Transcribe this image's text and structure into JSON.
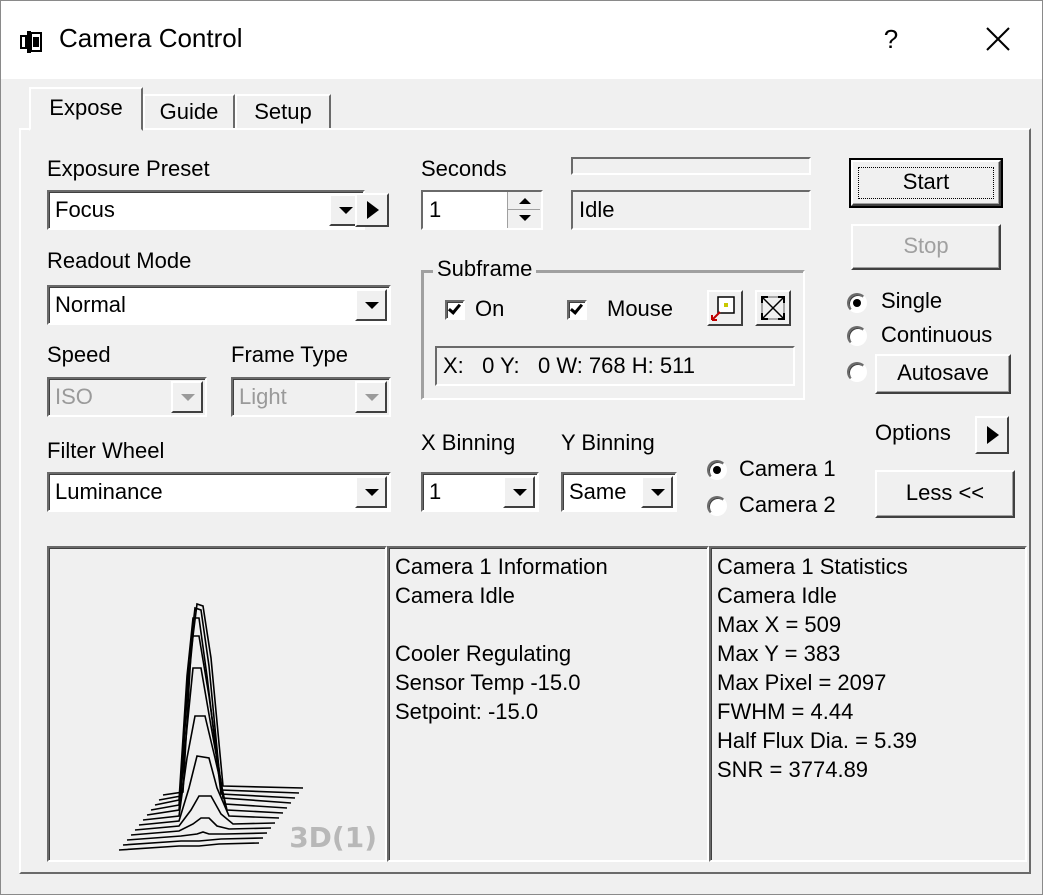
{
  "window": {
    "title": "Camera Control",
    "help_glyph": "?",
    "close_glyph": "✕"
  },
  "tabs": [
    {
      "label": "Expose",
      "active": true
    },
    {
      "label": "Guide",
      "active": false
    },
    {
      "label": "Setup",
      "active": false
    }
  ],
  "expose": {
    "exposure_preset_label": "Exposure Preset",
    "exposure_preset_value": "Focus",
    "seconds_label": "Seconds",
    "seconds_value": "1",
    "status_text": "Idle",
    "start_label": "Start",
    "stop_label": "Stop",
    "readout_mode_label": "Readout Mode",
    "readout_mode_value": "Normal",
    "speed_label": "Speed",
    "speed_value": "ISO",
    "frame_type_label": "Frame Type",
    "frame_type_value": "Light",
    "filter_wheel_label": "Filter Wheel",
    "filter_wheel_value": "Luminance",
    "subframe": {
      "title": "Subframe",
      "on_label": "On",
      "on_checked": true,
      "mouse_label": "Mouse",
      "mouse_checked": true,
      "coords": "X:   0 Y:   0 W: 768 H: 511"
    },
    "mode": {
      "single_label": "Single",
      "continuous_label": "Continuous",
      "autosave_label": "Autosave",
      "selected": "single"
    },
    "options_label": "Options",
    "x_binning_label": "X Binning",
    "x_binning_value": "1",
    "y_binning_label": "Y Binning",
    "y_binning_value": "Same",
    "camera": {
      "camera1_label": "Camera 1",
      "camera2_label": "Camera 2",
      "selected": "camera1"
    },
    "less_label": "Less <<"
  },
  "plot": {
    "label": "3D(1)"
  },
  "information": {
    "lines": [
      "Camera 1 Information",
      "Camera Idle",
      "",
      "Cooler Regulating",
      "Sensor Temp -15.0",
      "Setpoint: -15.0"
    ]
  },
  "statistics": {
    "lines": [
      "Camera 1 Statistics",
      "Camera Idle",
      "Max X = 509",
      "Max Y = 383",
      "Max Pixel = 2097",
      "FWHM = 4.44",
      "Half Flux Dia. = 5.39",
      "SNR = 3774.89"
    ]
  }
}
